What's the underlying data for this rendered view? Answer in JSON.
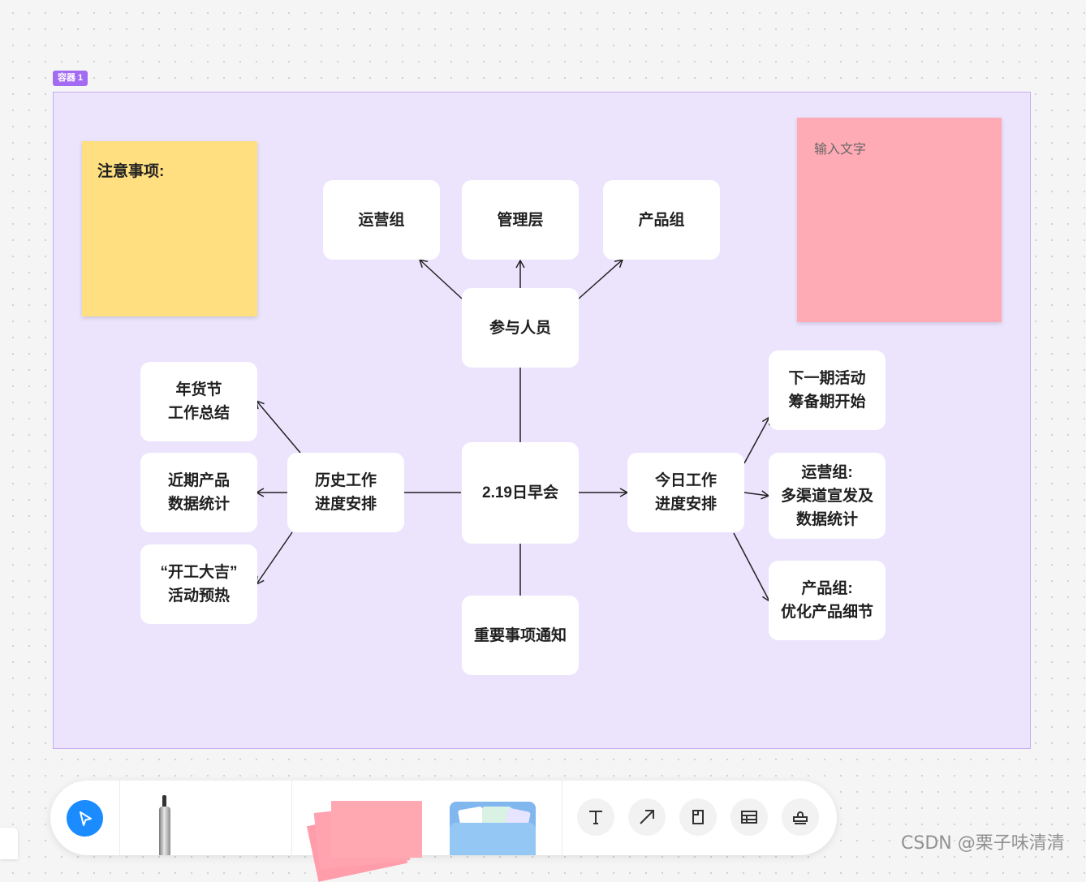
{
  "container": {
    "label": "容器 1"
  },
  "stickies": {
    "yellow": {
      "text": "注意事项:",
      "color": "#ffdf80"
    },
    "pink": {
      "placeholder": "输入文字",
      "color": "#ffabb6"
    }
  },
  "nodes": {
    "center": "2.19日早会",
    "participants": "参与人员",
    "ops_group": "运营组",
    "management": "管理层",
    "product_group": "产品组",
    "history_work": "历史工作\n进度安排",
    "new_year_summary": "年货节\n工作总结",
    "recent_product_stats": "近期产品\n数据统计",
    "kickoff_warmup": "“开工大吉”\n活动预热",
    "today_work": "今日工作\n进度安排",
    "next_activity": "下一期活动\n筹备期开始",
    "ops_task": "运营组:\n多渠道宣发及\n数据统计",
    "product_task": "产品组:\n优化产品细节",
    "notice": "重要事项通知"
  },
  "toolbar": {
    "tools": [
      "select-tool",
      "pen-tool",
      "sticky-note-tool",
      "material-folder-tool",
      "text-tool",
      "arrow-tool",
      "shape-tool",
      "table-tool",
      "stamp-tool"
    ]
  },
  "theme": {
    "container_bg": "#ece4fd",
    "accent": "#1a8cff",
    "tag": "#a36bf2"
  },
  "watermark": "CSDN @栗子味清清"
}
